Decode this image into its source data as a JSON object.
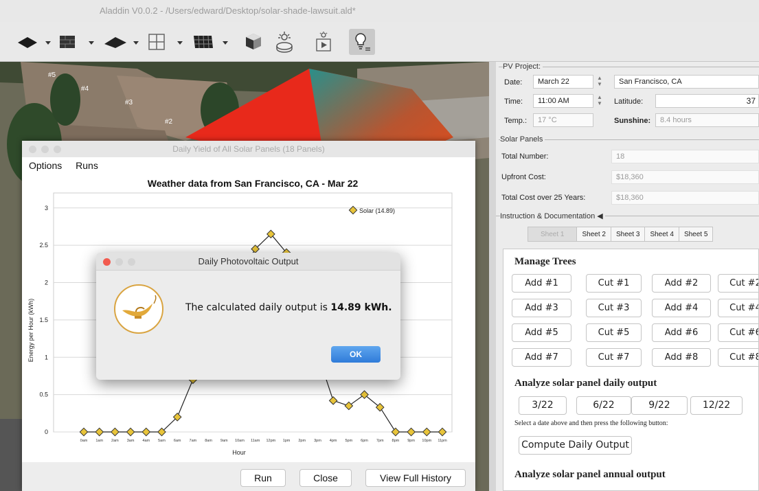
{
  "app": {
    "title": "Aladdin V0.0.2 - /Users/edward/Desktop/solar-shade-lawsuit.ald*"
  },
  "scene": {
    "labels": [
      "#5",
      "#4",
      "#3",
      "#2"
    ]
  },
  "pv_project": {
    "legend": "PV Project:",
    "date_label": "Date:",
    "date_value": "March 22",
    "city_value": "San Francisco, CA",
    "time_label": "Time:",
    "time_value": "11:00 AM",
    "latitude_label": "Latitude:",
    "latitude_value": "37",
    "temp_label": "Temp.:",
    "temp_value": "17 °C",
    "sunshine_label": "Sunshine:",
    "sunshine_value": "8.4 hours"
  },
  "solar_panels": {
    "legend": "Solar Panels",
    "total_number_label": "Total Number:",
    "total_number_value": "18",
    "upfront_cost_label": "Upfront Cost:",
    "upfront_cost_value": "$18,360",
    "total_cost_label": "Total Cost over 25 Years:",
    "total_cost_value": "$18,360"
  },
  "docs": {
    "legend": "Instruction & Documentation",
    "legend_arrow": "◀",
    "tabs": [
      "Sheet 1",
      "Sheet 2",
      "Sheet 3",
      "Sheet 4",
      "Sheet 5"
    ],
    "manage_trees": "Manage Trees",
    "tree_buttons": [
      "Add #1",
      "Cut #1",
      "Add #2",
      "Cut #2",
      "Add #3",
      "Cut #3",
      "Add #4",
      "Cut #4",
      "Add #5",
      "Cut #5",
      "Add #6",
      "Cut #6",
      "Add #7",
      "Cut #7",
      "Add #8",
      "Cut #8"
    ],
    "analyze_daily": "Analyze solar panel daily output",
    "date_buttons": [
      "3/22",
      "6/22",
      "9/22",
      "12/22"
    ],
    "instruction": "Select a date above and then press the following button:",
    "compute_button": "Compute Daily Output",
    "analyze_annual": "Analyze solar panel annual output"
  },
  "yield_window": {
    "title": "Daily Yield of All Solar Panels (18 Panels)",
    "menu": [
      "Options",
      "Runs"
    ],
    "buttons": {
      "run": "Run",
      "close": "Close",
      "history": "View Full History"
    }
  },
  "chart_data": {
    "type": "line",
    "title": "Weather data from San Francisco, CA - Mar 22",
    "xlabel": "Hour",
    "ylabel": "Energy per Hour (kWh)",
    "ylim": [
      0,
      3.2
    ],
    "yticks": [
      "0",
      "0.5",
      "1",
      "1.5",
      "2",
      "2.5",
      "3"
    ],
    "categories": [
      "0am",
      "1am",
      "2am",
      "3am",
      "4am",
      "5am",
      "6am",
      "7am",
      "8am",
      "9am",
      "10am",
      "11am",
      "12pm",
      "1pm",
      "2pm",
      "3pm",
      "4pm",
      "5pm",
      "6pm",
      "7pm",
      "8pm",
      "9pm",
      "10pm",
      "11pm"
    ],
    "series": [
      {
        "name": "Solar (14.89)",
        "color": "#e8c43a",
        "values": [
          0,
          0,
          0,
          0,
          0,
          0,
          0.2,
          0.7,
          1.2,
          1.7,
          2.1,
          2.45,
          2.65,
          2.4,
          1.7,
          1.05,
          0.42,
          0.35,
          0.5,
          0.33,
          0,
          0,
          0,
          0
        ]
      }
    ],
    "legend_position": "top-right",
    "grid": true
  },
  "dialog": {
    "title": "Daily Photovoltaic Output",
    "message": "The calculated daily output is ",
    "value": "14.89 kWh.",
    "ok": "OK"
  }
}
